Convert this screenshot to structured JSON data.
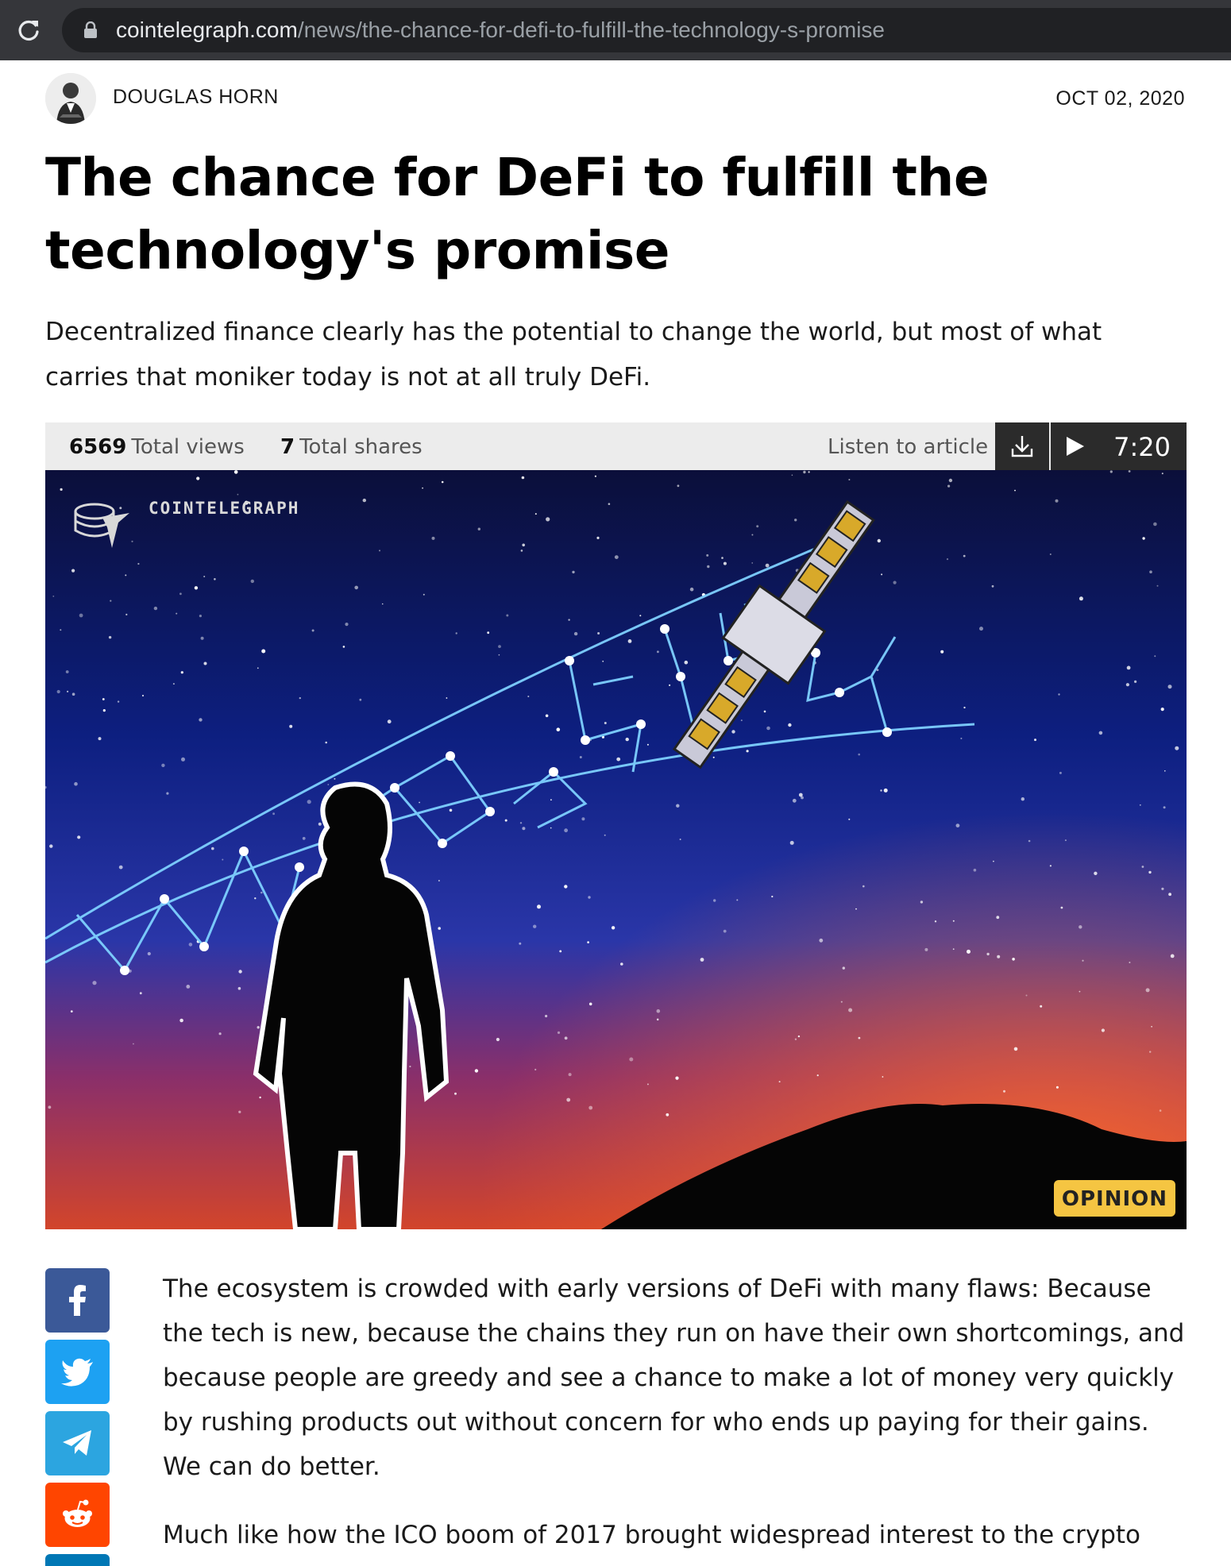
{
  "browser": {
    "url_domain": "cointelegraph.com",
    "url_path": "/news/the-chance-for-defi-to-fulfill-the-technology-s-promise"
  },
  "article": {
    "author": "DOUGLAS HORN",
    "date": "OCT 02, 2020",
    "title": "The chance for DeFi to fulfill the technology's promise",
    "lead": "Decentralized finance clearly has the potential to change the world, but most of what carries that moniker today is not at all truly DeFi.",
    "stats": {
      "views_count": "6569",
      "views_label": "Total views",
      "shares_count": "7",
      "shares_label": "Total shares",
      "listen_label": "Listen to article",
      "duration": "7:20"
    },
    "hero": {
      "logo_text": "COINTELEGRAPH",
      "badge": "OPINION",
      "constellation_text": "DeFi"
    },
    "paragraphs": [
      "The ecosystem is crowded with early versions of DeFi with many flaws: Because the tech is new, because the chains they run on have their own shortcomings, and because people are greedy and see a chance to make a lot of money very quickly by rushing products out without concern for who ends up paying for their gains. We can do better.",
      "Much like how the ICO boom of 2017 brought widespread interest to the crypto"
    ]
  },
  "share_buttons": [
    "facebook-icon",
    "twitter-icon",
    "telegram-icon",
    "reddit-icon",
    "linkedin-icon"
  ],
  "colors": {
    "facebook": "#3b5998",
    "twitter": "#1da1f2",
    "telegram": "#2ca5e0",
    "reddit": "#ff4500",
    "opinion_badge": "#f5c542"
  }
}
